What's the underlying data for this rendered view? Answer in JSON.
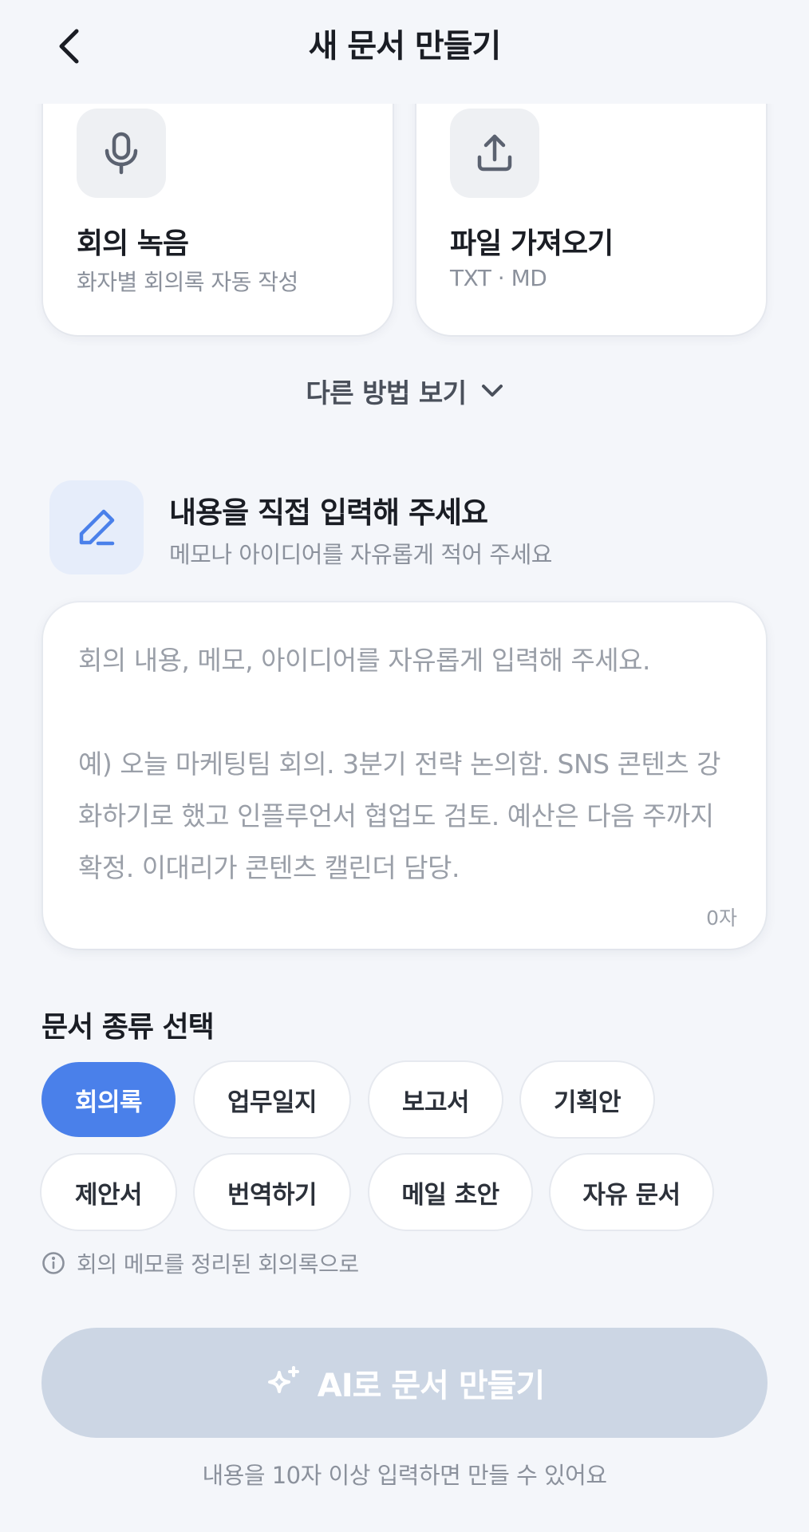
{
  "header": {
    "title": "새 문서 만들기",
    "back_icon": "chevron-left-icon"
  },
  "sources": [
    {
      "title": "회의 녹음",
      "subtitle": "화자별 회의록 자동 작성",
      "icon": "microphone-icon"
    },
    {
      "title": "파일 가져오기",
      "subtitle": "TXT · MD",
      "icon": "upload-icon"
    }
  ],
  "more_methods": {
    "label": "다른 방법 보기",
    "icon": "chevron-down-icon"
  },
  "direct_input": {
    "icon": "pencil-icon",
    "title": "내용을 직접 입력해 주세요",
    "subtitle": "메모나 아이디어를 자유롭게 적어 주세요",
    "value": "",
    "placeholder": "회의 내용, 메모, 아이디어를 자유롭게 입력해 주세요.\n\n예) 오늘 마케팅팀 회의. 3분기 전략 논의함. SNS 콘텐츠 강화하기로 했고 인플루언서 협업도 검토. 예산은 다음 주까지 확정. 이대리가 콘텐츠 캘린더 담당.",
    "char_count": "0자"
  },
  "doc_types": {
    "label": "문서 종류 선택",
    "selected": "회의록",
    "options": [
      "회의록",
      "업무일지",
      "보고서",
      "기획안",
      "제안서",
      "번역하기",
      "메일 초안",
      "자유 문서"
    ]
  },
  "hint": {
    "icon": "info-icon",
    "text": "회의 메모를 정리된 회의록으로"
  },
  "cta": {
    "label": "AI로 문서 만들기",
    "icon": "sparkle-icon",
    "note": "내용을 10자 이상 입력하면 만들 수 있어요"
  },
  "colors": {
    "accent": "#4a80ea",
    "background": "#f4f6fa",
    "cta_disabled": "#ccd6e4",
    "muted_text": "#8b919c"
  }
}
